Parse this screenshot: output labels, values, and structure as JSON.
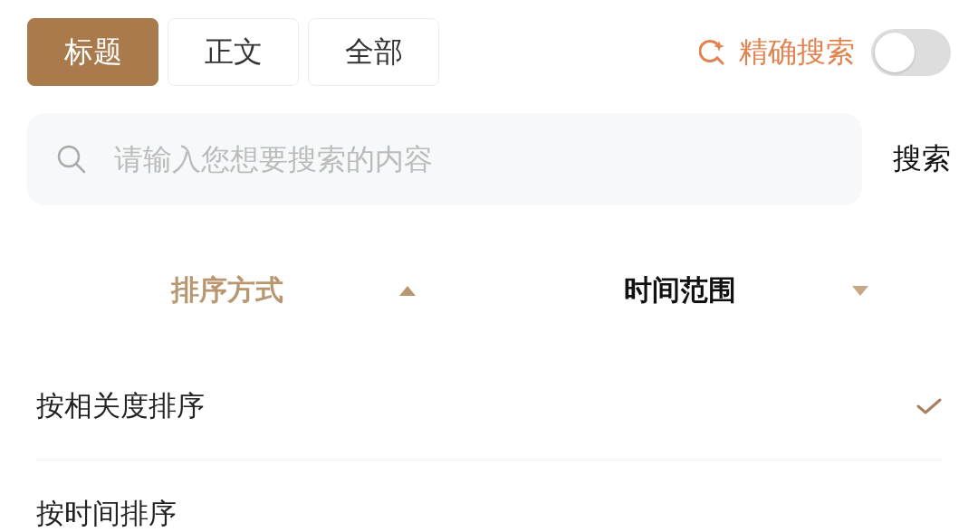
{
  "tabs": [
    {
      "label": "标题",
      "selected": true
    },
    {
      "label": "正文",
      "selected": false
    },
    {
      "label": "全部",
      "selected": false
    }
  ],
  "exact_search": {
    "label": "精确搜索",
    "on": false
  },
  "search": {
    "placeholder": "请输入您想要搜索的内容",
    "button": "搜索"
  },
  "filters": [
    {
      "label": "排序方式",
      "expanded": true
    },
    {
      "label": "时间范围",
      "expanded": false
    }
  ],
  "options": [
    {
      "label": "按相关度排序",
      "selected": true
    },
    {
      "label": "按时间排序",
      "selected": false
    }
  ]
}
